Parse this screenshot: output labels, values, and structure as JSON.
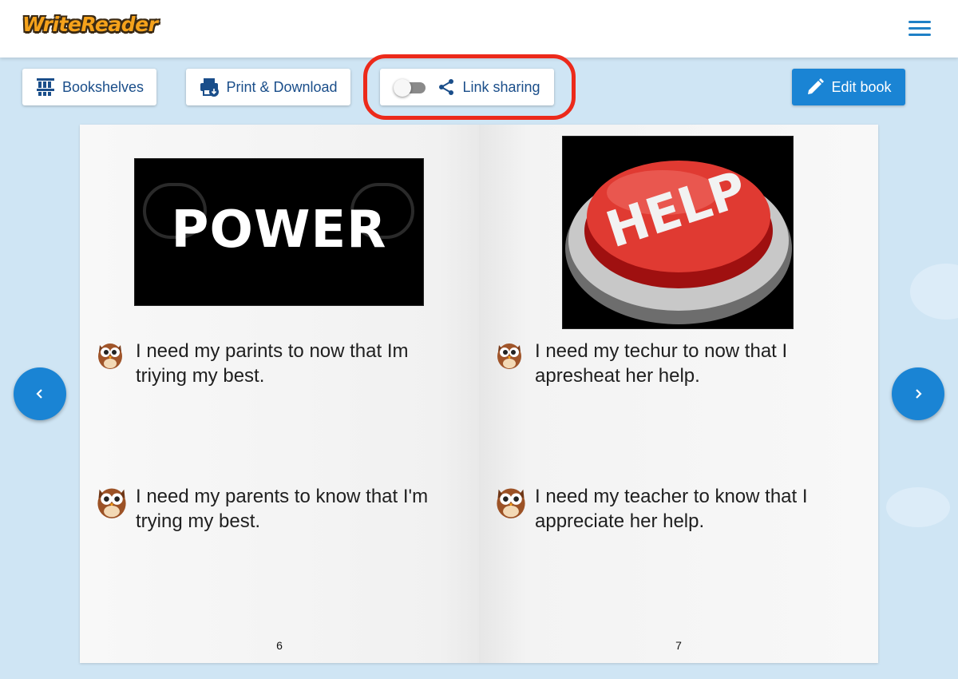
{
  "app": {
    "logo": "WriteReader"
  },
  "toolbar": {
    "bookshelves_label": "Bookshelves",
    "print_label": "Print & Download",
    "link_sharing_label": "Link sharing",
    "link_sharing_enabled": false,
    "edit_label": "Edit book"
  },
  "book": {
    "left_page": {
      "image": "POWER",
      "child_text": "I need my parints to now that Im triying my best.",
      "adult_text": "I need my parents to know that I'm trying my best.",
      "page_number": "6"
    },
    "right_page": {
      "image": "HELP",
      "child_text": "I need my techur to now that I apresheat her help.",
      "adult_text": "I need my teacher to know that I appreciate her help.",
      "page_number": "7"
    }
  },
  "colors": {
    "accent": "#1a84d4",
    "highlight": "#ec2a1b",
    "background": "#cfe5f4",
    "text": "#1a4e8a"
  },
  "icons": {
    "bookshelves": "bookshelf-icon",
    "print": "printer-icon",
    "link": "share-icon",
    "edit": "pencil-icon",
    "menu": "hamburger-menu-icon",
    "prev": "chevron-left-icon",
    "next": "chevron-right-icon"
  }
}
